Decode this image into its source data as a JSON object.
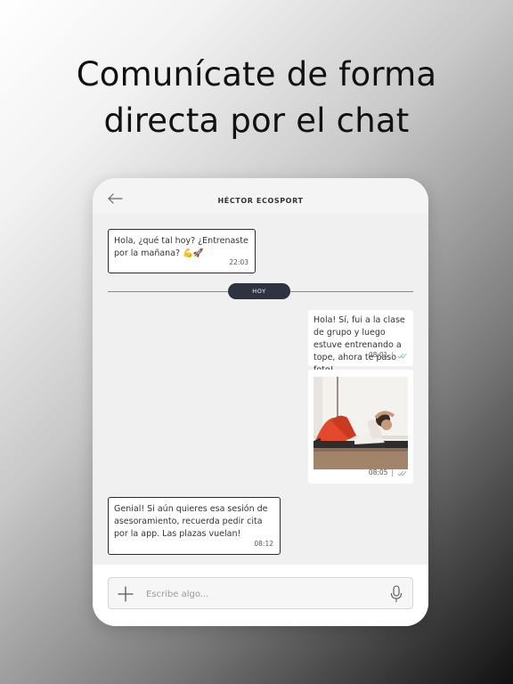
{
  "headline": {
    "line1": "Comunícate de forma",
    "line2": "directa por el chat"
  },
  "chat": {
    "contact_name": "HÉCTOR ECOSPORT",
    "day_separator": "HOY",
    "messages": [
      {
        "direction": "in",
        "text": "Hola, ¿qué tal hoy? ¿Entrenaste por la mañana? 💪🚀",
        "time": "22:03"
      },
      {
        "direction": "out",
        "text": "Hola! Sí, fui a la clase de grupo y luego estuve entrenando a tope, ahora te paso foto!",
        "time": "08:01",
        "status": "double-check-icon"
      },
      {
        "direction": "out",
        "type": "image",
        "image": "workout-situps-photo",
        "time": "08:05",
        "status": "double-check-icon"
      },
      {
        "direction": "in",
        "text": "Genial! Si aún quieres esa sesión de asesoramiento, recuerda pedir cita por la app. Las plazas vuelan!",
        "time": "08:12"
      }
    ]
  },
  "composer": {
    "placeholder": "Escribe algo...",
    "value": ""
  },
  "icons": {
    "back": "arrow-left-icon",
    "attach": "plus-icon",
    "voice": "microphone-icon",
    "read_status": "double-check-icon"
  },
  "colors": {
    "day_pill": "#2f3341",
    "read_ticks": "#6fc3b4",
    "chat_background": "#f0f0f0"
  }
}
